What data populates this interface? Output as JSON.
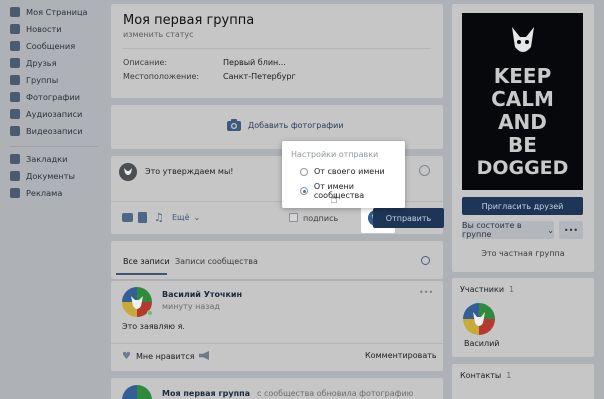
{
  "sidebar": {
    "items": [
      {
        "label": "Моя Страница",
        "icon": "home-icon"
      },
      {
        "label": "Новости",
        "icon": "news-icon"
      },
      {
        "label": "Сообщения",
        "icon": "messages-icon"
      },
      {
        "label": "Друзья",
        "icon": "friends-icon"
      },
      {
        "label": "Группы",
        "icon": "groups-icon"
      },
      {
        "label": "Фотографии",
        "icon": "photos-icon"
      },
      {
        "label": "Аудиозаписи",
        "icon": "music-icon"
      },
      {
        "label": "Видеозаписи",
        "icon": "video-icon"
      },
      {
        "label": "Закладки",
        "icon": "star-icon"
      },
      {
        "label": "Документы",
        "icon": "document-icon"
      },
      {
        "label": "Реклама",
        "icon": "ads-icon"
      }
    ]
  },
  "group": {
    "title": "Моя первая группа",
    "status_link": "изменить статус",
    "description_label": "Описание:",
    "description_value": "Первый блин...",
    "location_label": "Местоположение:",
    "location_value": "Санкт-Петербург"
  },
  "photos": {
    "add_label": "Добавить фотографии"
  },
  "composer": {
    "text": "Это утверждаем мы!",
    "more_label": "Ещё",
    "signature_label": "подпись",
    "send_label": "Отправить"
  },
  "send_popup": {
    "title": "Настройки отправки",
    "options": [
      "От своего имени",
      "От имени сообщества"
    ],
    "selected_index": 1
  },
  "tabs": {
    "all": "Все записи",
    "community": "Записи сообщества"
  },
  "post": {
    "author": "Василий Уточкин",
    "time": "минуту назад",
    "text": "Это заявляю я.",
    "like_label": "Мне нравится",
    "comment_label": "Комментировать"
  },
  "post2": {
    "author": "Моя первая группа",
    "suffix": "с сообщества обновила фотографию"
  },
  "poster": {
    "lines": [
      "KEEP",
      "CALM",
      "AND",
      "BE",
      "DOGGED"
    ]
  },
  "right": {
    "invite_label": "Пригласить друзей",
    "member_label": "Вы состоите в группе",
    "more_label": "•••",
    "privacy_label": "Это частная группа",
    "members_title": "Участники",
    "members_count": "1",
    "member_name": "Василий",
    "contacts_title": "Контакты",
    "contacts_count": "1"
  },
  "colors": {
    "accent": "#4a76a8",
    "dark_button": "#1d3557",
    "overlay_bg": "#aeb1b5"
  }
}
